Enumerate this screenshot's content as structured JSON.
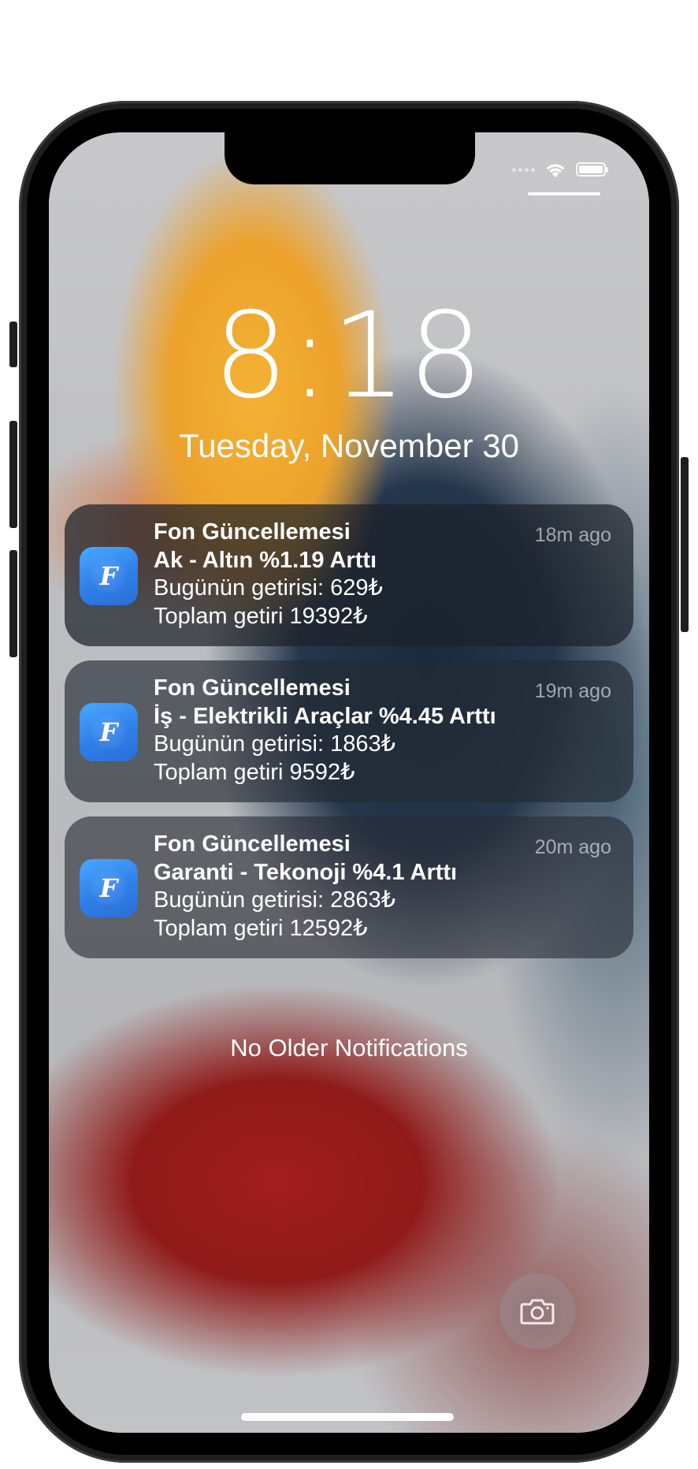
{
  "lock_screen": {
    "time": "8:18",
    "date": "Tuesday, November 30"
  },
  "status_bar": {
    "icons": [
      "signal-icon",
      "wifi-icon",
      "battery-icon"
    ]
  },
  "notifications": [
    {
      "app_icon": "fon-app-icon",
      "app_icon_letter": "F",
      "title": "Fon Güncellemesi",
      "subtitle": "Ak - Altın %1.19 Arttı",
      "line3": "Bugünün getirisi: 629₺",
      "line4": "Toplam getiri 19392₺",
      "time": "18m ago"
    },
    {
      "app_icon": "fon-app-icon",
      "app_icon_letter": "F",
      "title": "Fon Güncellemesi",
      "subtitle": "İş - Elektrikli Araçlar %4.45 Arttı",
      "line3": "Bugünün getirisi: 1863₺",
      "line4": "Toplam getiri 9592₺",
      "time": "19m ago"
    },
    {
      "app_icon": "fon-app-icon",
      "app_icon_letter": "F",
      "title": "Fon Güncellemesi",
      "subtitle": "Garanti - Tekonoji %4.1 Arttı",
      "line3": "Bugünün getirisi: 2863₺",
      "line4": "Toplam getiri 12592₺",
      "time": "20m ago"
    }
  ],
  "footer": {
    "no_older": "No Older Notifications",
    "camera_icon": "camera-icon"
  },
  "colors": {
    "app_icon": "#2f7fe8",
    "notification_bg": "#1c212a"
  }
}
